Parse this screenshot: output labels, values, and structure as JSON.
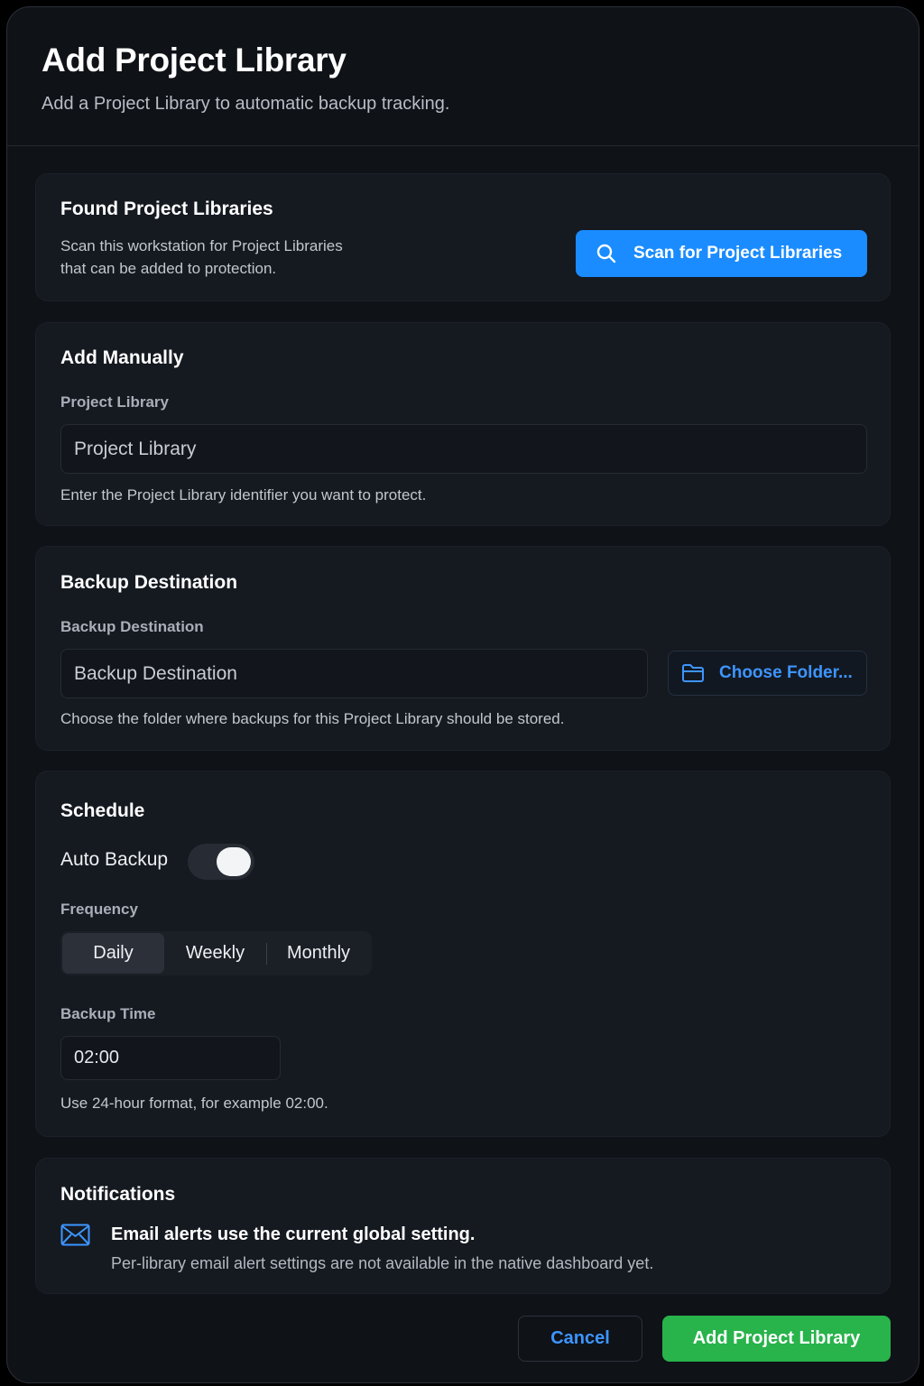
{
  "dialog": {
    "title": "Add Project Library",
    "subtitle": "Add a Project Library to automatic backup tracking."
  },
  "found": {
    "title": "Found Project Libraries",
    "description_line1": "Scan this workstation for Project Libraries",
    "description_line2": "that can be added to protection.",
    "scan_button_label": "Scan for Project Libraries",
    "scan_icon": "search-icon"
  },
  "manual": {
    "title": "Add Manually",
    "field_label": "Project Library",
    "input_placeholder": "Project Library",
    "input_value": "",
    "help": "Enter the Project Library identifier you want to protect."
  },
  "destination": {
    "title": "Backup Destination",
    "field_label": "Backup Destination",
    "input_placeholder": "Backup Destination",
    "input_value": "",
    "choose_button_label": "Choose Folder...",
    "choose_icon": "folder-icon",
    "help": "Choose the folder where backups for this Project Library should be stored."
  },
  "schedule": {
    "title": "Schedule",
    "auto_backup_label": "Auto Backup",
    "auto_backup_on": true,
    "frequency_label": "Frequency",
    "frequency_options": [
      "Daily",
      "Weekly",
      "Monthly"
    ],
    "frequency_selected": "Daily",
    "time_label": "Backup Time",
    "time_value": "02:00",
    "time_help": "Use 24-hour format, for example 02:00."
  },
  "notifications": {
    "title": "Notifications",
    "icon": "envelope-icon",
    "headline": "Email alerts use the current global setting.",
    "detail": "Per-library email alert settings are not available in the native dashboard yet."
  },
  "footer": {
    "cancel_label": "Cancel",
    "submit_label": "Add Project Library"
  },
  "colors": {
    "primary_blue": "#1a8cff",
    "link_blue": "#3d95ff",
    "success_green": "#28b34b",
    "dialog_bg": "#0f1217",
    "card_bg": "#151920"
  }
}
